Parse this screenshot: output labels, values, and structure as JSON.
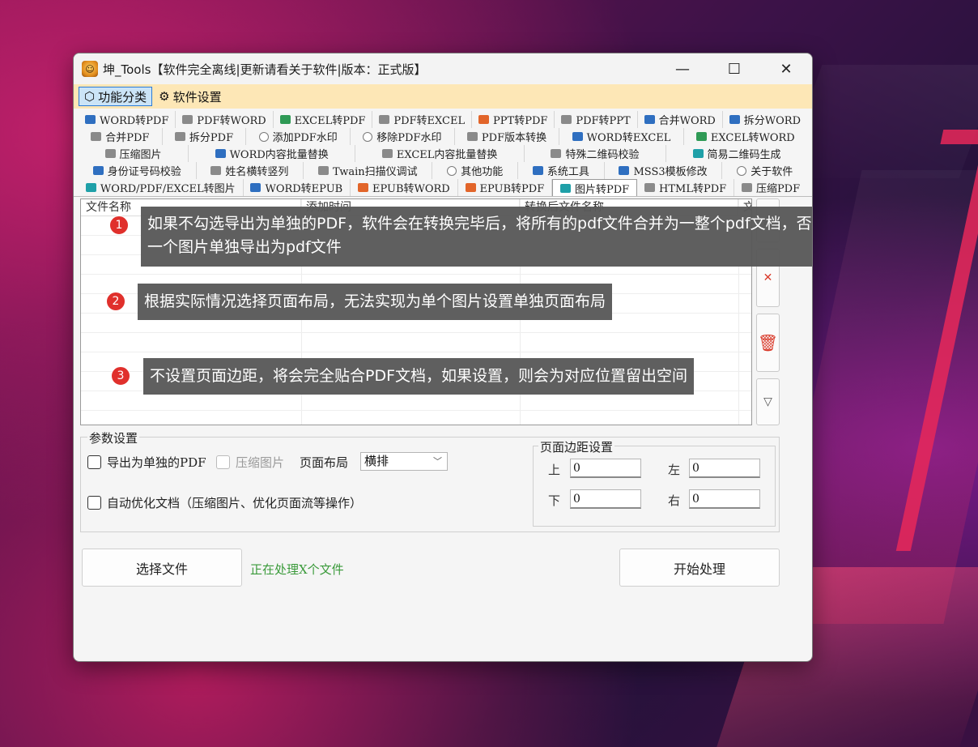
{
  "window": {
    "title": "坤_Tools【软件完全离线|更新请看关于软件|版本：正式版】",
    "minimize": "—",
    "maximize": "☐",
    "close": "✕"
  },
  "menubar": {
    "items": [
      {
        "label": "功能分类",
        "icon": "cube-icon",
        "active": true
      },
      {
        "label": "软件设置",
        "icon": "gear-icon",
        "active": false
      }
    ]
  },
  "tabs": {
    "rows": [
      [
        "WORD转PDF",
        "PDF转WORD",
        "EXCEL转PDF",
        "PDF转EXCEL",
        "PPT转PDF",
        "PDF转PPT",
        "合并WORD",
        "拆分WORD"
      ],
      [
        "合并PDF",
        "拆分PDF",
        "添加PDF水印",
        "移除PDF水印",
        "PDF版本转换",
        "WORD转EXCEL",
        "EXCEL转WORD"
      ],
      [
        "压缩图片",
        "WORD内容批量替换",
        "EXCEL内容批量替换",
        "特殊二维码校验",
        "简易二维码生成"
      ],
      [
        "身份证号码校验",
        "姓名横转竖列",
        "Twain扫描仪调试",
        "其他功能",
        "系统工具",
        "MSS3模板修改",
        "关于软件"
      ],
      [
        "WORD/PDF/EXCEL转图片",
        "WORD转EPUB",
        "EPUB转WORD",
        "EPUB转PDF",
        "图片转PDF",
        "HTML转PDF",
        "压缩PDF"
      ]
    ],
    "selected": "图片转PDF"
  },
  "table": {
    "columns": [
      "文件名称",
      "添加时间",
      "转换后文件名称",
      "文"
    ]
  },
  "side_buttons": {
    "up": "△",
    "remove": "✕",
    "clear": "🗑",
    "down": "▽"
  },
  "tooltips": [
    {
      "badge": "1",
      "text": "如果不勾选导出为单独的PDF，软件会在转换完毕后，将所有的pdf文件合并为一整个pdf文档，否则将每一个图片单独导出为pdf文件"
    },
    {
      "badge": "2",
      "text": "根据实际情况选择页面布局，无法实现为单个图片设置单独页面布局"
    },
    {
      "badge": "3",
      "text": "不设置页面边距，将会完全贴合PDF文档，如果设置，则会为对应位置留出空间"
    }
  ],
  "params": {
    "legend": "参数设置",
    "export_single": "导出为单独的PDF",
    "compress_images": "压缩图片",
    "layout_label": "页面布局",
    "layout_value": "横排",
    "auto_optimize": "自动优化文档（压缩图片、优化页面流等操作）",
    "margins": {
      "legend": "页面边距设置",
      "top_label": "上",
      "top": "0",
      "left_label": "左",
      "left": "0",
      "bottom_label": "下",
      "bottom": "0",
      "right_label": "右",
      "right": "0"
    }
  },
  "actions": {
    "select_files": "选择文件",
    "status": "正在处理X个文件",
    "start": "开始处理"
  },
  "colors": {
    "menubar_bg": "#fde7b6",
    "accent_blue": "#2b7bd6",
    "badge_red": "#e0302c",
    "status_green": "#3a9a3a"
  }
}
